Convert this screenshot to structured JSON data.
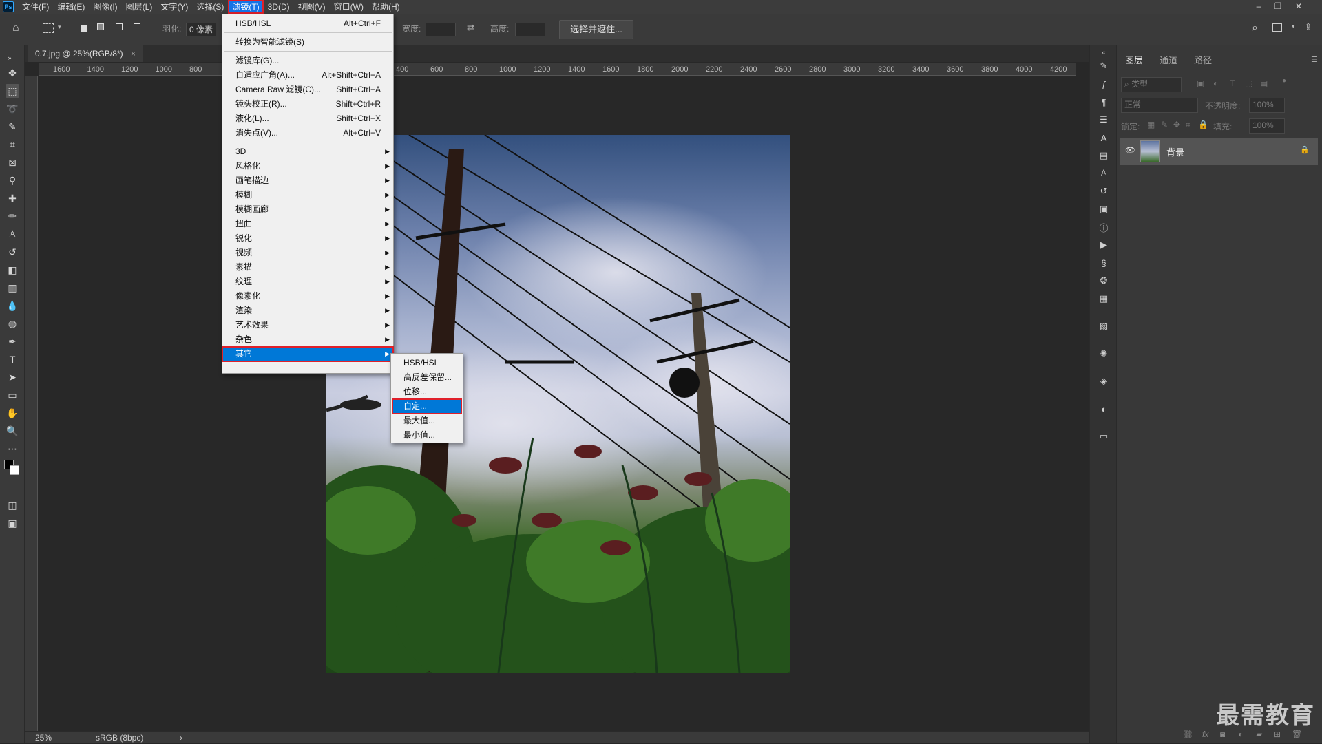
{
  "app": {
    "logo": "Ps",
    "menus": [
      "文件(F)",
      "编辑(E)",
      "图像(I)",
      "图层(L)",
      "文字(Y)",
      "选择(S)",
      "滤镜(T)",
      "3D(D)",
      "视图(V)",
      "窗口(W)",
      "帮助(H)"
    ],
    "active_menu_index": 6
  },
  "options_bar": {
    "feather_label": "羽化:",
    "feather_value": "0 像素",
    "width_label": "宽度:",
    "height_label": "高度:",
    "select_mask_button": "选择并遮住..."
  },
  "document": {
    "tab_title": "0.7.jpg @ 25%(RGB/8*)",
    "tab_close": "×",
    "zoom": "25%",
    "color_profile": "sRGB (8bpc)",
    "status_arrow": "›"
  },
  "ruler": {
    "left_labels": [
      "1600",
      "1400",
      "1200",
      "1000",
      "800"
    ],
    "right_labels": [
      "400",
      "600",
      "800",
      "1000",
      "1200",
      "1400",
      "1600",
      "1800",
      "2000",
      "2200",
      "2400",
      "2600",
      "2800",
      "3000",
      "3200",
      "3400",
      "3600",
      "3800",
      "4000",
      "4200"
    ]
  },
  "filter_menu": {
    "top_items": [
      {
        "label": "HSB/HSL",
        "shortcut": "Alt+Ctrl+F"
      },
      {
        "label": "转换为智能滤镜(S)",
        "shortcut": ""
      }
    ],
    "mid_items": [
      {
        "label": "滤镜库(G)...",
        "shortcut": ""
      },
      {
        "label": "自适应广角(A)...",
        "shortcut": "Alt+Shift+Ctrl+A"
      },
      {
        "label": "Camera Raw 滤镜(C)...",
        "shortcut": "Shift+Ctrl+A"
      },
      {
        "label": "镜头校正(R)...",
        "shortcut": "Shift+Ctrl+R"
      },
      {
        "label": "液化(L)...",
        "shortcut": "Shift+Ctrl+X"
      },
      {
        "label": "消失点(V)...",
        "shortcut": "Alt+Ctrl+V"
      }
    ],
    "submenus": [
      "3D",
      "风格化",
      "画笔描边",
      "模糊",
      "模糊画廊",
      "扭曲",
      "锐化",
      "视频",
      "素描",
      "纹理",
      "像素化",
      "渲染",
      "艺术效果",
      "杂色",
      "其它"
    ],
    "highlighted": "其它"
  },
  "other_submenu": {
    "items": [
      "HSB/HSL",
      "高反差保留...",
      "位移...",
      "自定...",
      "最大值...",
      "最小值..."
    ],
    "highlighted": "自定..."
  },
  "layers_panel": {
    "tabs": [
      "图层",
      "通道",
      "路径"
    ],
    "filter_placeholder": "类型",
    "blend_mode": "正常",
    "opacity_label": "不透明度:",
    "opacity_value": "100%",
    "lock_label": "锁定:",
    "fill_label": "填充:",
    "fill_value": "100%",
    "layer_name": "背景"
  },
  "watermark": "最需教育",
  "colors": {
    "accent": "#1473e6",
    "highlight": "#0078d7",
    "annotation_red": "#e0202a"
  }
}
